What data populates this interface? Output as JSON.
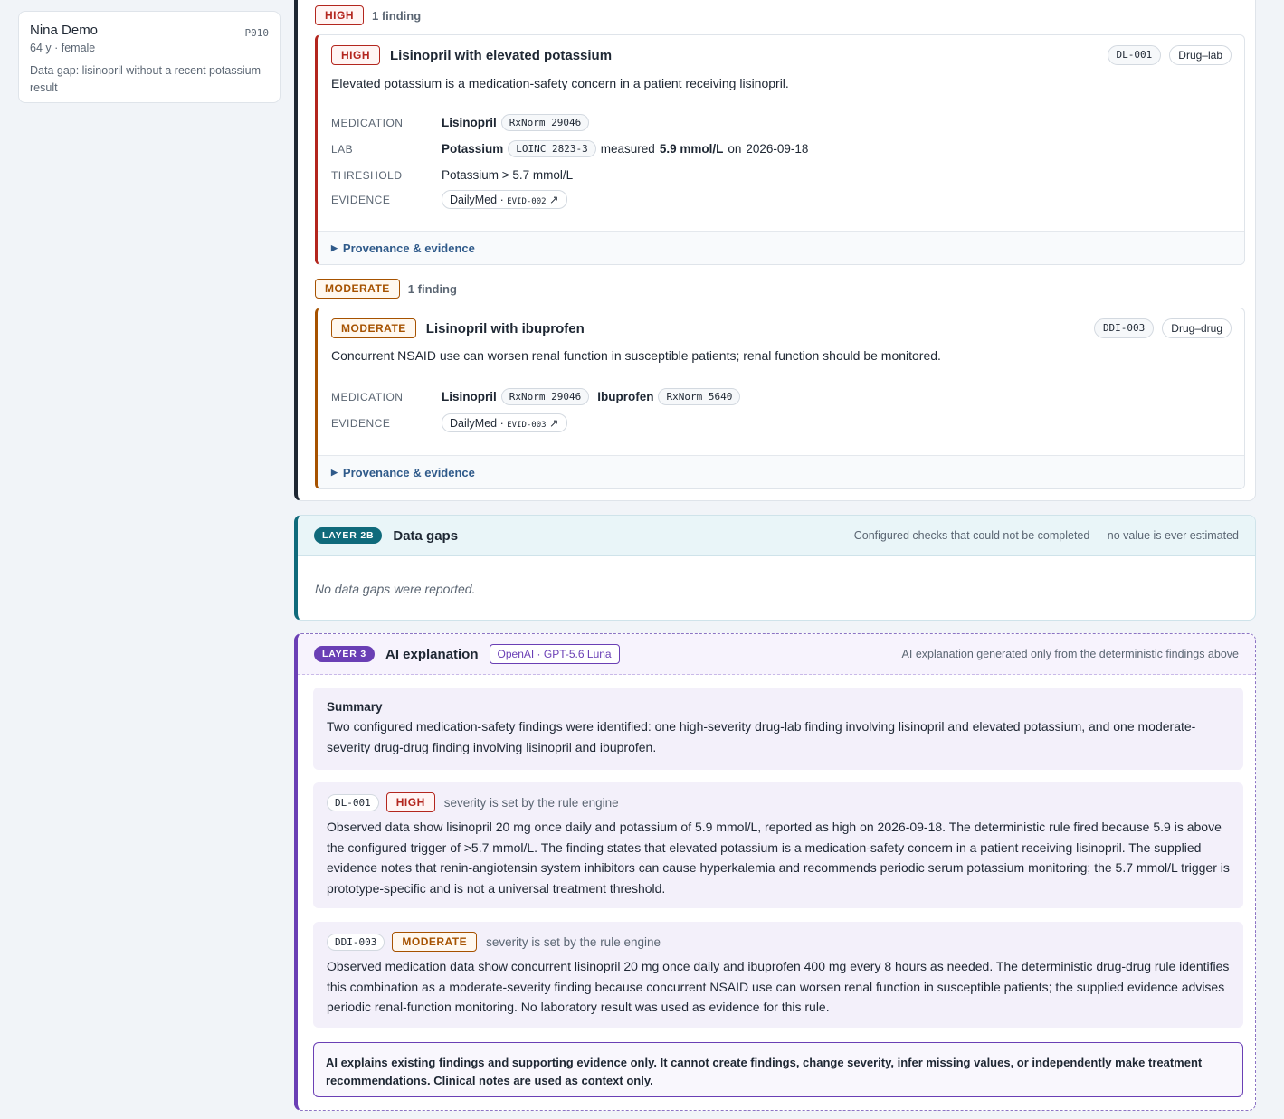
{
  "patient": {
    "name": "Nina Demo",
    "id": "P010",
    "meta": "64 y · female",
    "gap_note": "Data gap: lisinopril without a recent potassium result"
  },
  "groups": {
    "high": {
      "badge": "HIGH",
      "count": "1 finding"
    },
    "moderate": {
      "badge": "MODERATE",
      "count": "1 finding"
    }
  },
  "findings": [
    {
      "severity": "HIGH",
      "title": "Lisinopril with elevated potassium",
      "rule_id": "DL-001",
      "rule_type": "Drug–lab",
      "description": "Elevated potassium is a medication-safety concern in a patient receiving lisinopril.",
      "labels": {
        "medication": "MEDICATION",
        "lab": "LAB",
        "threshold": "THRESHOLD",
        "evidence": "EVIDENCE"
      },
      "medication": {
        "name": "Lisinopril",
        "code": "RxNorm 29046"
      },
      "lab": {
        "name": "Potassium",
        "code": "LOINC 2823-3",
        "measured_label": "measured",
        "value": "5.9 mmol/L",
        "on_label": "on",
        "date": "2026-09-18"
      },
      "threshold": "Potassium > 5.7 mmol/L",
      "evidence": {
        "source": "DailyMed",
        "sep": " · ",
        "id": "EVID-002",
        "arrow": " ↗"
      },
      "provenance": "Provenance & evidence"
    },
    {
      "severity": "MODERATE",
      "title": "Lisinopril with ibuprofen",
      "rule_id": "DDI-003",
      "rule_type": "Drug–drug",
      "description": "Concurrent NSAID use can worsen renal function in susceptible patients; renal function should be monitored.",
      "labels": {
        "medication": "MEDICATION",
        "evidence": "EVIDENCE"
      },
      "medications": [
        {
          "name": "Lisinopril",
          "code": "RxNorm 29046"
        },
        {
          "name": "Ibuprofen",
          "code": "RxNorm 5640"
        }
      ],
      "evidence": {
        "source": "DailyMed",
        "sep": " · ",
        "id": "EVID-003",
        "arrow": " ↗"
      },
      "provenance": "Provenance & evidence"
    }
  ],
  "layer2b": {
    "pill": "LAYER 2B",
    "title": "Data gaps",
    "note": "Configured checks that could not be completed — no value is ever estimated",
    "empty": "No data gaps were reported."
  },
  "layer3": {
    "pill": "LAYER 3",
    "title": "AI explanation",
    "model": "OpenAI · GPT-5.6 Luna",
    "note": "AI explanation generated only from the deterministic findings above",
    "summary_title": "Summary",
    "summary": "Two configured medication-safety findings were identified: one high-severity drug-lab finding involving lisinopril and elevated potassium, and one moderate-severity drug-drug finding involving lisinopril and ibuprofen.",
    "explanations": [
      {
        "rule_id": "DL-001",
        "severity": "HIGH",
        "severity_note": "severity is set by the rule engine",
        "text": "Observed data show lisinopril 20 mg once daily and potassium of 5.9 mmol/L, reported as high on 2026-09-18. The deterministic rule fired because 5.9 is above the configured trigger of >5.7 mmol/L. The finding states that elevated potassium is a medication-safety concern in a patient receiving lisinopril. The supplied evidence notes that renin-angiotensin system inhibitors can cause hyperkalemia and recommends periodic serum potassium monitoring; the 5.7 mmol/L trigger is prototype-specific and is not a universal treatment threshold."
      },
      {
        "rule_id": "DDI-003",
        "severity": "MODERATE",
        "severity_note": "severity is set by the rule engine",
        "text": "Observed medication data show concurrent lisinopril 20 mg once daily and ibuprofen 400 mg every 8 hours as needed. The deterministic drug-drug rule identifies this combination as a moderate-severity finding because concurrent NSAID use can worsen renal function in susceptible patients; the supplied evidence advises periodic renal-function monitoring. No laboratory result was used as evidence for this rule."
      }
    ],
    "disclaimer": "AI explains existing findings and supporting evidence only. It cannot create findings, change severity, infer missing values, or independently make treatment recommendations. Clinical notes are used as context only."
  },
  "colors": {
    "high": "#b3261e",
    "moderate": "#a65200",
    "layer2b": "#0f6a7b",
    "layer3": "#6a3fb5",
    "link": "#2f5a8a"
  }
}
